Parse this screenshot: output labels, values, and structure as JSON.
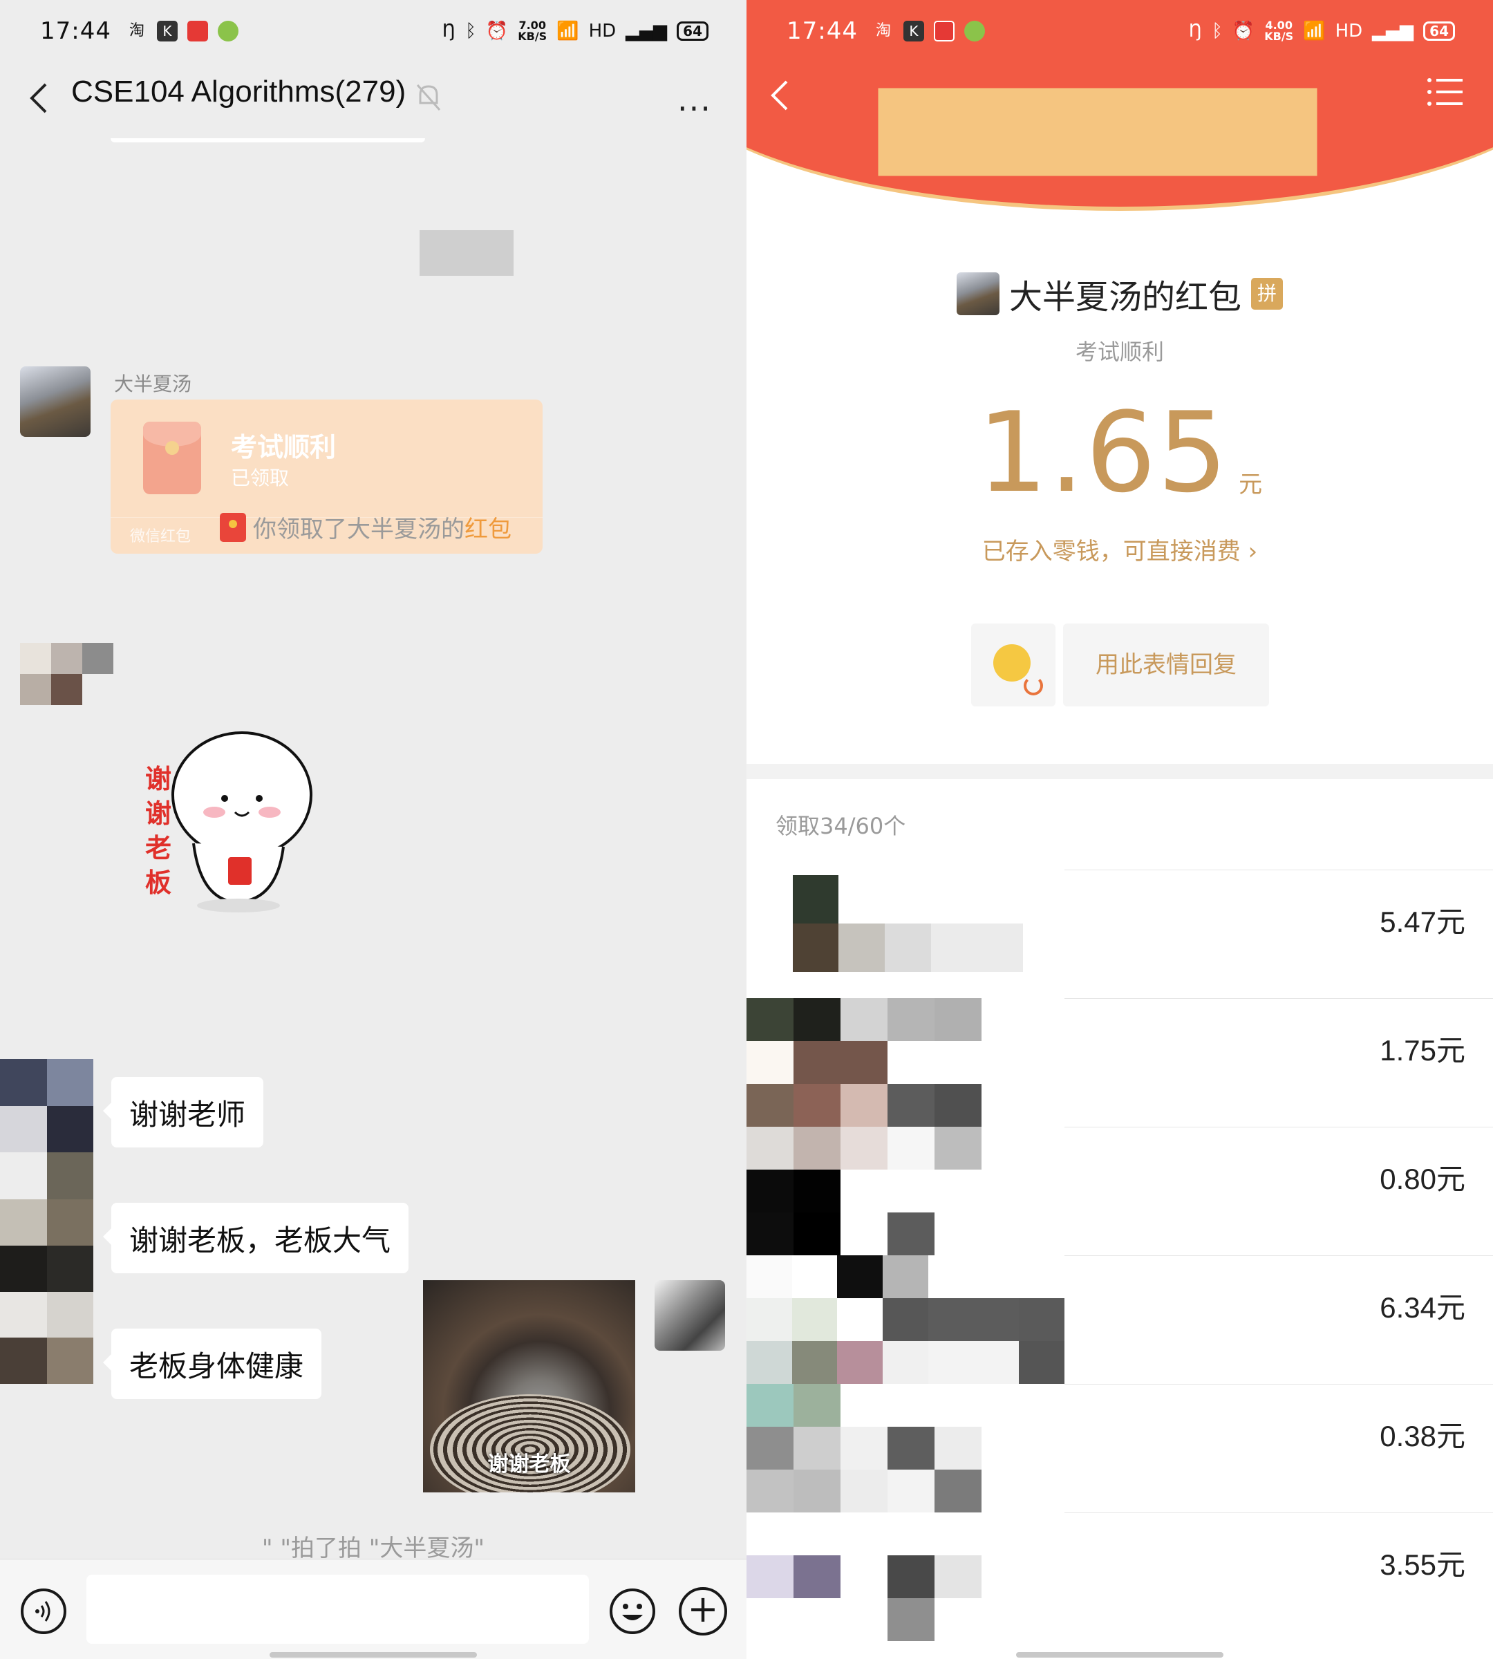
{
  "status_bar": {
    "time": "17:44",
    "left_speed": "7.00",
    "right_speed": "4.00",
    "speed_unit": "KB/S",
    "hd_label": "HD",
    "battery": "64"
  },
  "chat": {
    "title": "CSE104 Algorithms(279)",
    "more_label": "···",
    "sender_name": "大半夏汤",
    "redpacket": {
      "blessing": "考试顺利",
      "status": "已领取",
      "footer": "微信红包"
    },
    "system_note_prefix": "你领取了大半夏汤的",
    "system_note_highlight": "红包",
    "sticker_text": "谢谢老板",
    "messages": [
      {
        "text": "谢谢老师"
      },
      {
        "text": "谢谢老板，老板大气"
      },
      {
        "text": "老板身体健康"
      }
    ],
    "gif_caption": "谢谢老板",
    "pat_note": "\" \"拍了拍 \"大半夏汤\""
  },
  "detail": {
    "sender_title": "大半夏汤的红包",
    "pin_badge": "拼",
    "blessing": "考试顺利",
    "amount": "1.65",
    "unit": "元",
    "wallet_link": "已存入零钱，可直接消费 ›",
    "emoji_reply_label": "用此表情回复",
    "claim_count": "领取34/60个",
    "receivers": [
      {
        "amount": "5.47元"
      },
      {
        "amount": "1.75元"
      },
      {
        "amount": "0.80元"
      },
      {
        "amount": "6.34元"
      },
      {
        "amount": "0.38元"
      },
      {
        "amount": "3.55元"
      }
    ]
  },
  "colors": {
    "accent_orange": "#ef9a3c",
    "redpacket_card": "#fbdfc4",
    "header_red": "#f25a44",
    "gold": "#c8995b"
  }
}
